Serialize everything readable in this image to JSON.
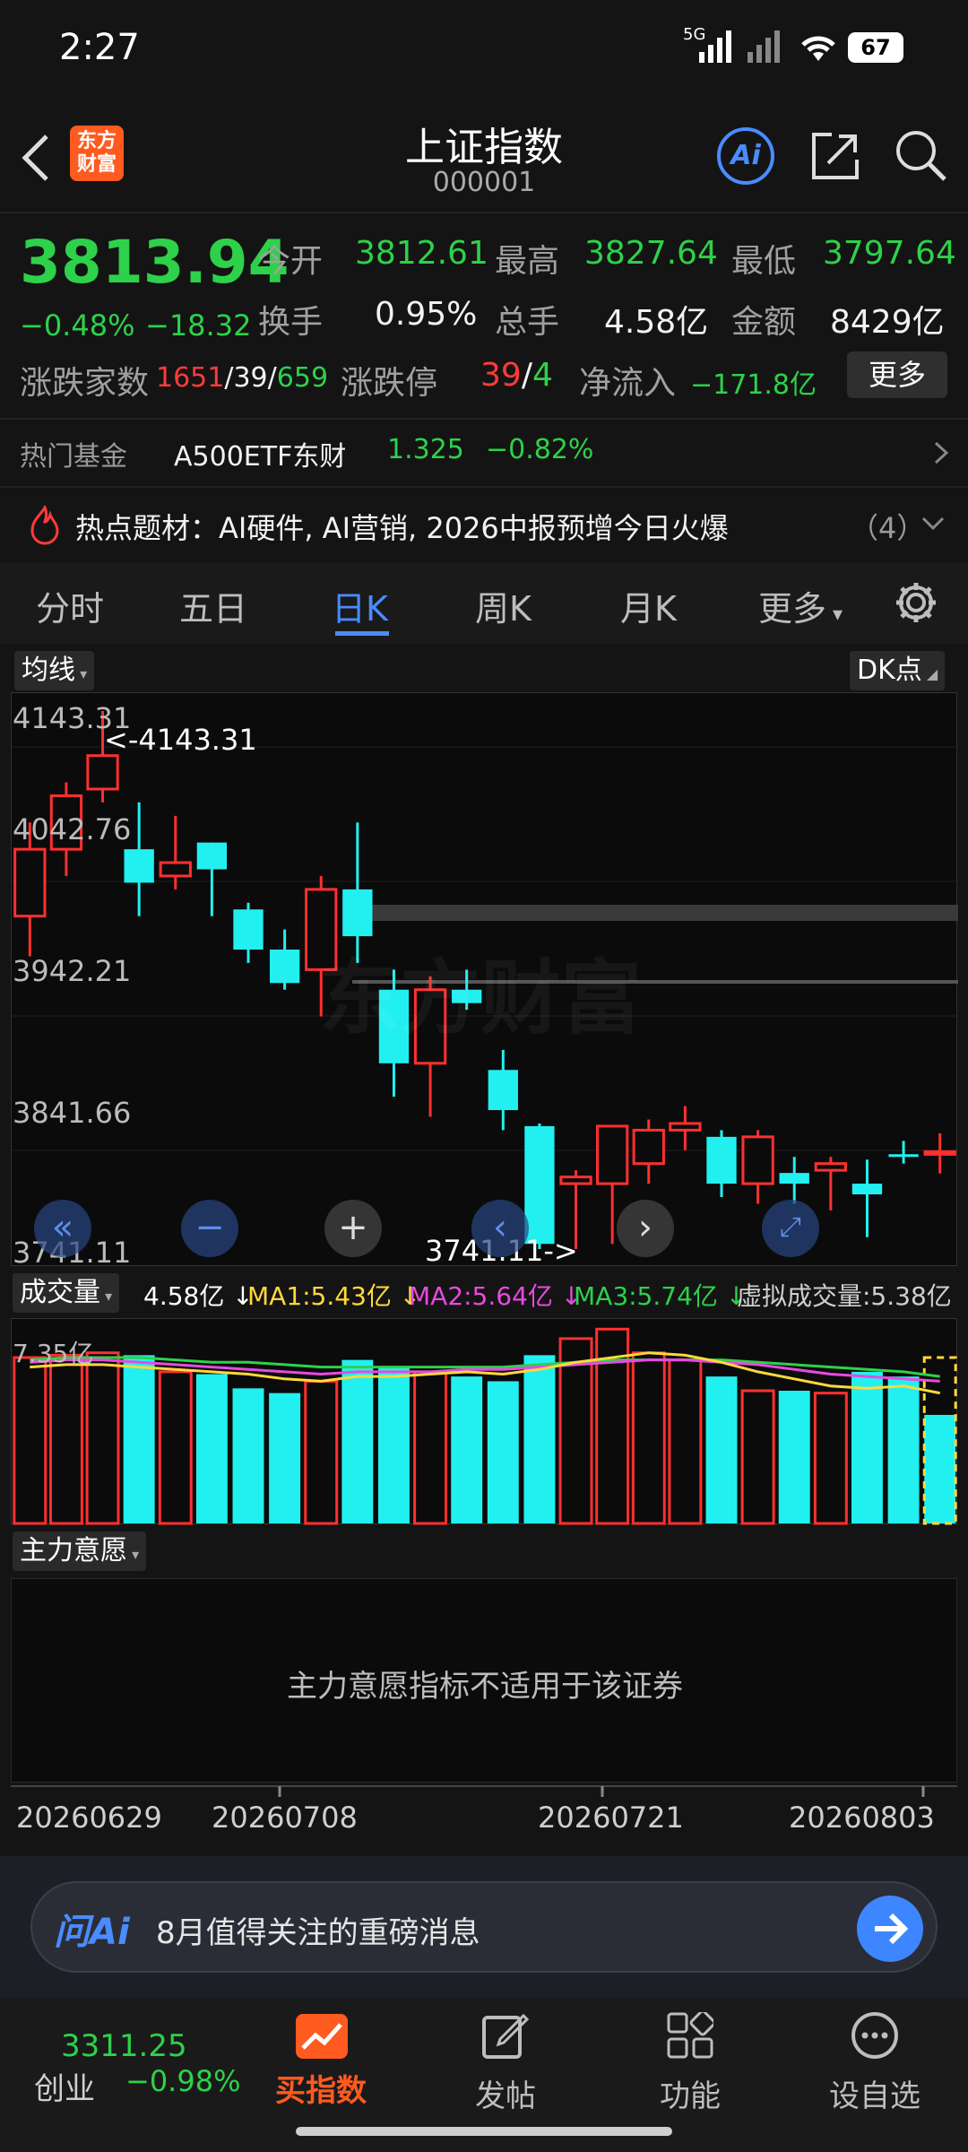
{
  "status": {
    "time": "2:27",
    "network": "5G",
    "battery": "67"
  },
  "header": {
    "title": "上证指数",
    "code": "000001",
    "logo_line1": "东方",
    "logo_line2": "财富",
    "ai_label": "Ai"
  },
  "quote": {
    "price": "3813.94",
    "change_pct": "−0.48%",
    "change": "−18.32",
    "open_label": "今开",
    "open": "3812.61",
    "high_label": "最高",
    "high": "3827.64",
    "low_label": "最低",
    "low": "3797.64",
    "turnover_label": "换手",
    "turnover": "0.95%",
    "volume_label": "总手",
    "volume": "4.58亿",
    "amount_label": "金额",
    "amount": "8429亿",
    "breadth_label": "涨跌家数",
    "up": "1651",
    "flat": "39",
    "down": "659",
    "slash": "/",
    "limit_label": "涨跌停",
    "limit_up": "39",
    "limit_down": "4",
    "netflow_label": "净流入",
    "netflow": "−171.8亿",
    "more": "更多"
  },
  "fund": {
    "label": "热门基金",
    "name": "A500ETF东财",
    "price": "1.325",
    "change": "−0.82%"
  },
  "hot": {
    "text": "热点题材：AI硬件, AI营销, 2026中报预增今日火爆",
    "count": "（4）"
  },
  "tabs": [
    "分时",
    "五日",
    "日K",
    "周K",
    "月K",
    "更多"
  ],
  "active_tab": 2,
  "kchart": {
    "indicator": "均线",
    "dk": "DK点",
    "y_labels": [
      "4143.31",
      "4042.76",
      "3942.21",
      "3841.66",
      "3741.11"
    ],
    "max_label": "<-4143.31",
    "min_label": "3741.11->",
    "watermark": "东方财富"
  },
  "volume": {
    "label": "成交量",
    "value": "4.58亿",
    "ma1": "MA1:5.43亿",
    "ma2": "MA2:5.64亿",
    "ma3": "MA3:5.74亿",
    "virtual": "虚拟成交量:5.38亿",
    "y_label": "7.35亿"
  },
  "mainforce": {
    "label": "主力意愿",
    "message": "主力意愿指标不适用于该证券"
  },
  "dates": [
    "20260629",
    "20260708",
    "20260721",
    "20260803"
  ],
  "ask": {
    "brand": "问Ai",
    "text": "8月值得关注的重磅消息"
  },
  "bottom": {
    "gem_price": "3311.25",
    "gem_label": "创业",
    "gem_change": "−0.98%",
    "items": [
      "买指数",
      "发帖",
      "功能",
      "设自选"
    ]
  },
  "chart_data": {
    "type": "candlestick",
    "ylim": [
      3741.11,
      4143.31
    ],
    "candles": [
      {
        "o": 3990,
        "c": 4040,
        "h": 4060,
        "l": 3960,
        "dir": "up"
      },
      {
        "o": 4040,
        "c": 4080,
        "h": 4090,
        "l": 4020,
        "dir": "up"
      },
      {
        "o": 4085,
        "c": 4110,
        "h": 4143.31,
        "l": 4075,
        "dir": "up"
      },
      {
        "o": 4040,
        "c": 4015,
        "h": 4075,
        "l": 3990,
        "dir": "down"
      },
      {
        "o": 4020,
        "c": 4030,
        "h": 4065,
        "l": 4010,
        "dir": "up"
      },
      {
        "o": 4045,
        "c": 4025,
        "h": 4045,
        "l": 3990,
        "dir": "down"
      },
      {
        "o": 3995,
        "c": 3965,
        "h": 4000,
        "l": 3955,
        "dir": "down"
      },
      {
        "o": 3965,
        "c": 3940,
        "h": 3980,
        "l": 3935,
        "dir": "down"
      },
      {
        "o": 3950,
        "c": 4010,
        "h": 4020,
        "l": 3915,
        "dir": "up"
      },
      {
        "o": 4010,
        "c": 3975,
        "h": 4060,
        "l": 3955,
        "dir": "down"
      },
      {
        "o": 3935,
        "c": 3880,
        "h": 3950,
        "l": 3855,
        "dir": "down"
      },
      {
        "o": 3880,
        "c": 3935,
        "h": 3945,
        "l": 3840,
        "dir": "up"
      },
      {
        "o": 3935,
        "c": 3925,
        "h": 3950,
        "l": 3920,
        "dir": "down"
      },
      {
        "o": 3875,
        "c": 3845,
        "h": 3890,
        "l": 3830,
        "dir": "down"
      },
      {
        "o": 3833,
        "c": 3745,
        "h": 3835,
        "l": 3741.11,
        "dir": "down"
      },
      {
        "o": 3790,
        "c": 3795,
        "h": 3800,
        "l": 3741.11,
        "dir": "up"
      },
      {
        "o": 3790,
        "c": 3833,
        "h": 3833,
        "l": 3745,
        "dir": "up"
      },
      {
        "o": 3805,
        "c": 3830,
        "h": 3838,
        "l": 3790,
        "dir": "up"
      },
      {
        "o": 3830,
        "c": 3835,
        "h": 3848,
        "l": 3815,
        "dir": "up"
      },
      {
        "o": 3825,
        "c": 3790,
        "h": 3830,
        "l": 3780,
        "dir": "down"
      },
      {
        "o": 3790,
        "c": 3825,
        "h": 3830,
        "l": 3775,
        "dir": "up"
      },
      {
        "o": 3798,
        "c": 3790,
        "h": 3810,
        "l": 3775,
        "dir": "down"
      },
      {
        "o": 3800,
        "c": 3805,
        "h": 3810,
        "l": 3770,
        "dir": "up"
      },
      {
        "o": 3790,
        "c": 3782,
        "h": 3808,
        "l": 3750,
        "dir": "down"
      },
      {
        "o": 3812,
        "c": 3812,
        "h": 3822,
        "l": 3805,
        "dir": "down"
      },
      {
        "o": 3812.61,
        "c": 3813.94,
        "h": 3827.64,
        "l": 3797.64,
        "dir": "up"
      }
    ],
    "volumes": [
      7.0,
      7.1,
      7.2,
      7.1,
      6.4,
      6.3,
      5.7,
      5.5,
      6.0,
      6.9,
      6.6,
      6.4,
      6.2,
      6.0,
      7.1,
      7.8,
      8.2,
      7.2,
      6.9,
      6.2,
      5.6,
      5.6,
      5.5,
      6.4,
      6.2,
      4.58
    ],
    "vol_ylim": [
      0,
      8.4
    ],
    "ma1": [
      6.6,
      6.7,
      6.7,
      6.6,
      6.5,
      6.4,
      6.3,
      6.1,
      6.0,
      6.2,
      6.2,
      6.3,
      6.4,
      6.3,
      6.5,
      6.8,
      7.0,
      7.2,
      7.1,
      6.8,
      6.4,
      6.1,
      5.8,
      5.7,
      5.8,
      5.5
    ],
    "ma2": [
      6.8,
      6.9,
      6.9,
      6.8,
      6.7,
      6.6,
      6.5,
      6.4,
      6.3,
      6.4,
      6.4,
      6.4,
      6.5,
      6.5,
      6.6,
      6.7,
      6.8,
      6.9,
      6.9,
      6.8,
      6.7,
      6.5,
      6.3,
      6.2,
      6.1,
      6.0
    ],
    "ma3": [
      6.9,
      7.0,
      7.0,
      7.0,
      6.9,
      6.8,
      6.8,
      6.7,
      6.6,
      6.6,
      6.6,
      6.6,
      6.6,
      6.6,
      6.7,
      6.8,
      6.9,
      6.9,
      6.9,
      6.9,
      6.8,
      6.7,
      6.6,
      6.5,
      6.4,
      6.2
    ]
  }
}
